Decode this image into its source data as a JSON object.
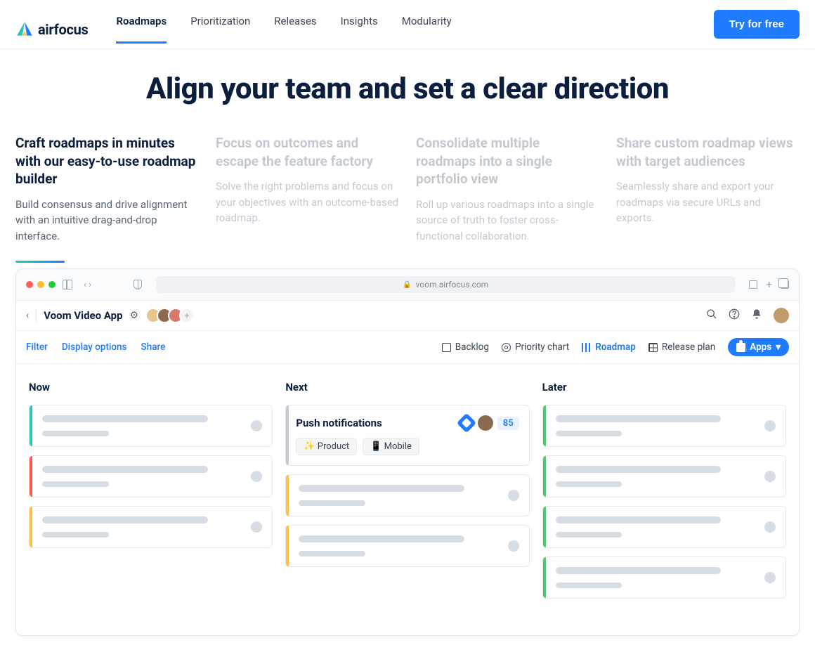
{
  "nav": {
    "brand": "airfocus",
    "items": [
      "Roadmaps",
      "Prioritization",
      "Releases",
      "Insights",
      "Modularity"
    ],
    "active_index": 0,
    "cta": "Try for free"
  },
  "hero": {
    "title": "Align your team and set a clear direction"
  },
  "features": [
    {
      "title": "Craft roadmaps in minutes with our easy-to-use roadmap builder",
      "desc": "Build consensus and drive alignment with an intuitive drag-and-drop interface.",
      "active": true
    },
    {
      "title": "Focus on outcomes and escape the feature factory",
      "desc": "Solve the right problems and focus on your objectives with an outcome-based roadmap."
    },
    {
      "title": "Consolidate multiple roadmaps into a single portfolio view",
      "desc": "Roll up various roadmaps into a single source of truth to foster cross-functional collaboration."
    },
    {
      "title": "Share custom roadmap views with target audiences",
      "desc": "Seamlessly share and export your roadmaps via secure URLs and exports."
    }
  ],
  "browser": {
    "url": "voom.airfocus.com"
  },
  "app": {
    "title": "Voom Video App",
    "sub_links": [
      "Filter",
      "Display options",
      "Share"
    ],
    "views": [
      {
        "label": "Backlog",
        "icon": "box"
      },
      {
        "label": "Priority chart",
        "icon": "target"
      },
      {
        "label": "Roadmap",
        "icon": "bars",
        "active": true
      },
      {
        "label": "Release plan",
        "icon": "grid"
      }
    ],
    "apps_button": "Apps"
  },
  "board": {
    "columns": [
      {
        "title": "Now",
        "cards": [
          {
            "kind": "skel",
            "color": "teal"
          },
          {
            "kind": "skel",
            "color": "red"
          },
          {
            "kind": "skel",
            "color": "amber"
          }
        ]
      },
      {
        "title": "Next",
        "cards": [
          {
            "kind": "rich",
            "color": "grey",
            "title": "Push notifications",
            "score": "85",
            "chips": [
              "✨ Product",
              "📱 Mobile"
            ]
          },
          {
            "kind": "skel",
            "color": "amber"
          },
          {
            "kind": "skel",
            "color": "amber"
          }
        ]
      },
      {
        "title": "Later",
        "cards": [
          {
            "kind": "skel",
            "color": "green"
          },
          {
            "kind": "skel",
            "color": "green"
          },
          {
            "kind": "skel",
            "color": "green"
          },
          {
            "kind": "skel",
            "color": "green"
          }
        ]
      }
    ]
  }
}
